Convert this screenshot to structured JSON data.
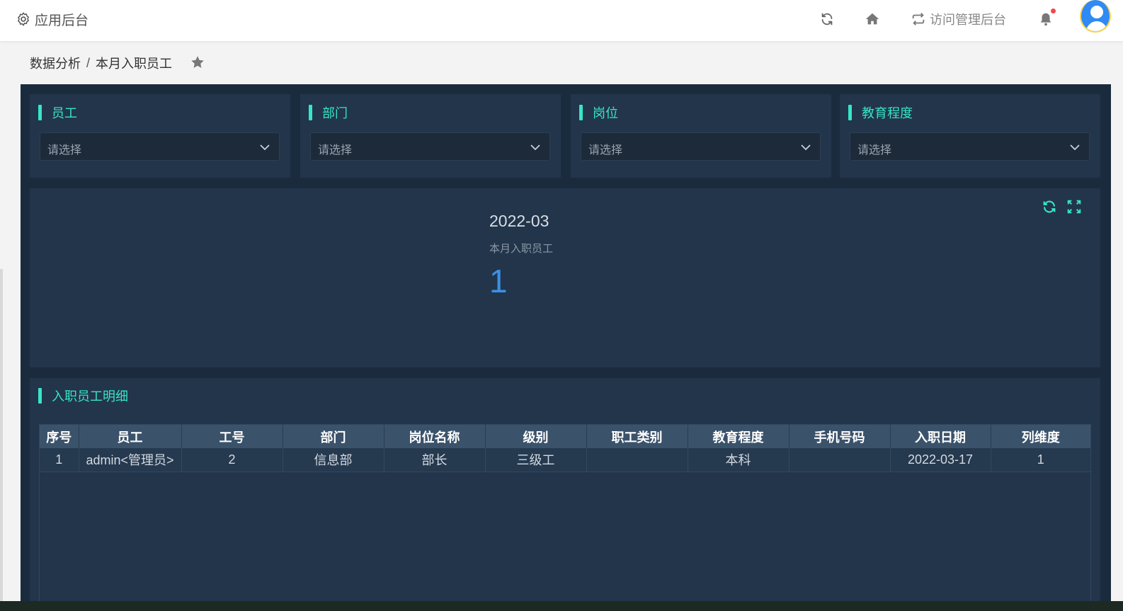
{
  "header": {
    "app_title": "应用后台",
    "visit_admin": "访问管理后台",
    "icons": [
      "settings-icon",
      "refresh-icon",
      "home-icon",
      "switch-icon",
      "bell-icon",
      "avatar"
    ]
  },
  "breadcrumb": {
    "items": [
      "数据分析",
      "本月入职员工"
    ],
    "separator": "/"
  },
  "filters": [
    {
      "label": "员工",
      "placeholder": "请选择"
    },
    {
      "label": "部门",
      "placeholder": "请选择"
    },
    {
      "label": "岗位",
      "placeholder": "请选择"
    },
    {
      "label": "教育程度",
      "placeholder": "请选择"
    }
  ],
  "stat": {
    "date": "2022-03",
    "label": "本月入职员工",
    "value": "1"
  },
  "detail": {
    "title": "入职员工明细",
    "columns": [
      "序号",
      "员工",
      "工号",
      "部门",
      "岗位名称",
      "级别",
      "职工类别",
      "教育程度",
      "手机号码",
      "入职日期",
      "列维度"
    ],
    "rows": [
      [
        "1",
        "admin<管理员>",
        "2",
        "信息部",
        "部长",
        "三级工",
        "",
        "本科",
        "",
        "2022-03-17",
        "1"
      ]
    ]
  },
  "colors": {
    "accent": "#37e5c7",
    "stat_value": "#3c91e6",
    "panel": "#22354b",
    "board": "#1b2b3e"
  }
}
